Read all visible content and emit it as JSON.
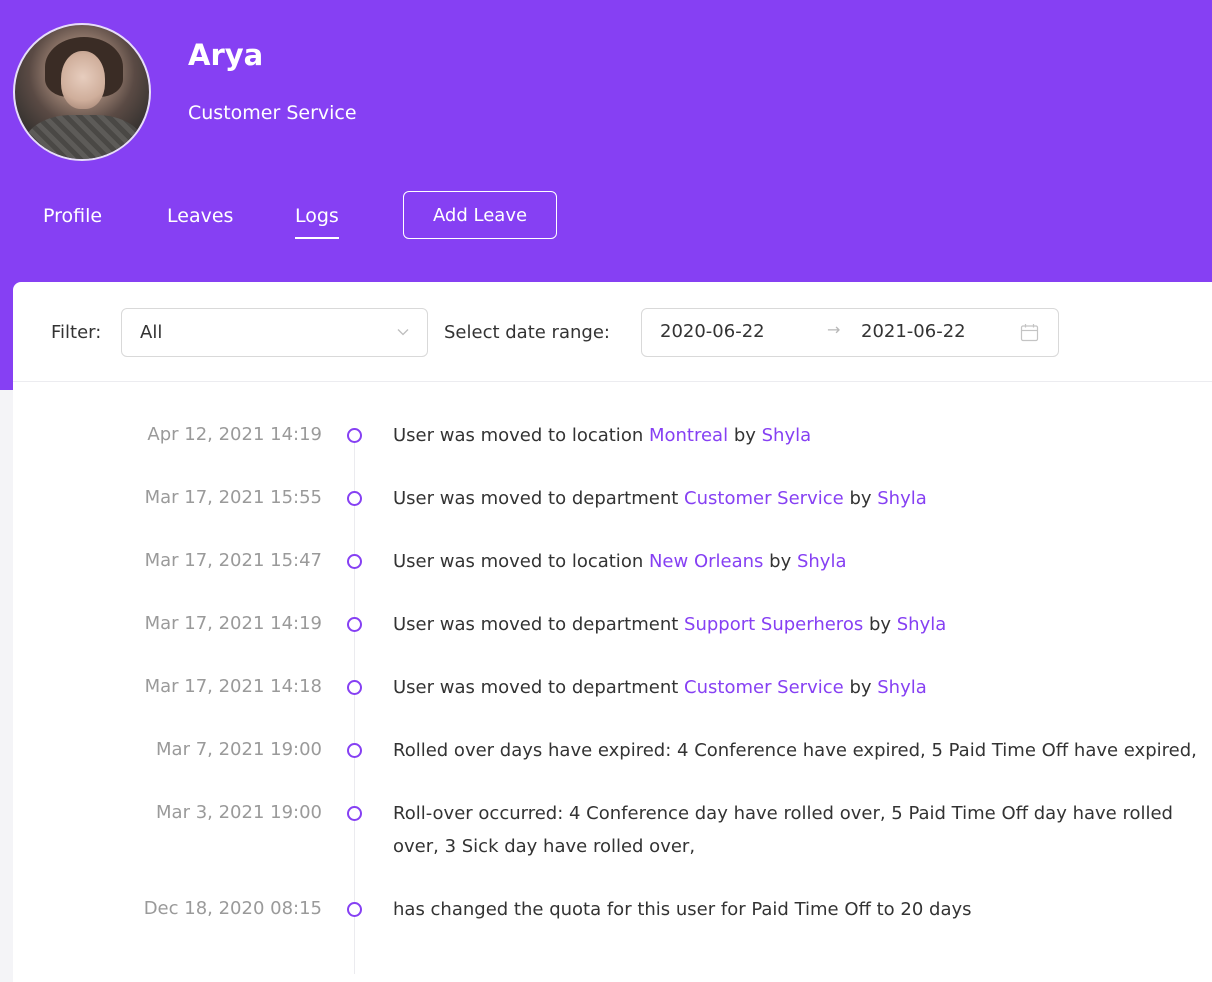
{
  "user": {
    "name": "Arya",
    "department": "Customer Service"
  },
  "nav": {
    "tabs": [
      {
        "label": "Profile"
      },
      {
        "label": "Leaves"
      },
      {
        "label": "Logs"
      }
    ],
    "active_tab": "Logs",
    "add_leave_label": "Add Leave"
  },
  "filters": {
    "filter_label": "Filter:",
    "filter_value": "All",
    "date_label": "Select date range:",
    "date_start": "2020-06-22",
    "date_arrow": "→",
    "date_end": "2021-06-22"
  },
  "logs": [
    {
      "time": "Apr 12, 2021 14:19",
      "pre": "User was moved to location ",
      "link": "Montreal",
      "mid": " by ",
      "actor": "Shyla"
    },
    {
      "time": "Mar 17, 2021 15:55",
      "pre": "User was moved to department ",
      "link": "Customer Service",
      "mid": " by ",
      "actor": "Shyla"
    },
    {
      "time": "Mar 17, 2021 15:47",
      "pre": "User was moved to location ",
      "link": "New Orleans",
      "mid": " by ",
      "actor": "Shyla"
    },
    {
      "time": "Mar 17, 2021 14:19",
      "pre": "User was moved to department ",
      "link": "Support Superheros",
      "mid": " by ",
      "actor": "Shyla"
    },
    {
      "time": "Mar 17, 2021 14:18",
      "pre": "User was moved to department ",
      "link": "Customer Service",
      "mid": " by ",
      "actor": "Shyla"
    },
    {
      "time": "Mar 7, 2021 19:00",
      "text": "Rolled over days have expired: 4 Conference have expired, 5 Paid Time Off have expired,"
    },
    {
      "time": "Mar 3, 2021 19:00",
      "text": "Roll-over occurred: 4 Conference day have rolled over, 5 Paid Time Off day have rolled over, 3 Sick day have rolled over,"
    },
    {
      "time": "Dec 18, 2020 08:15",
      "text": "has changed the quota for this user for Paid Time Off to 20 days"
    }
  ],
  "colors": {
    "accent": "#8640f3",
    "muted": "#9a9a9a"
  }
}
